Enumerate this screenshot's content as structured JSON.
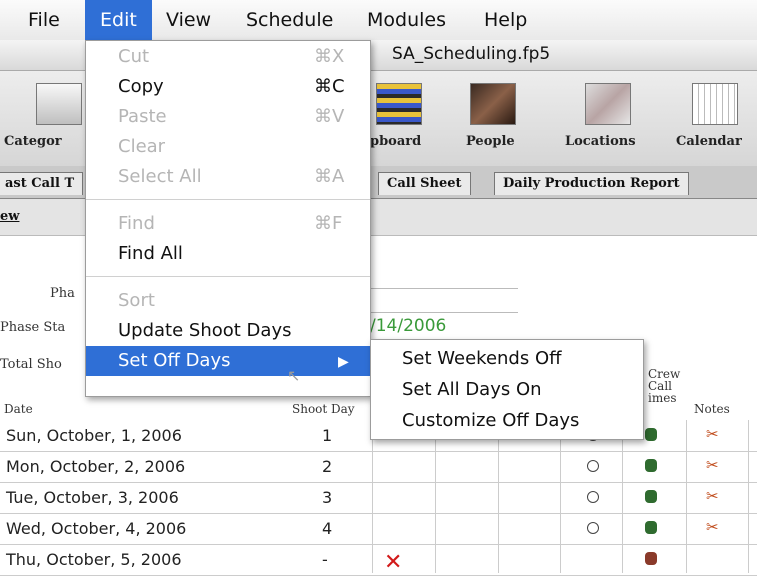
{
  "menubar": {
    "items": [
      "File",
      "Edit",
      "View",
      "Schedule",
      "Modules",
      "Help"
    ]
  },
  "window": {
    "title": "SA_Scheduling.fp5"
  },
  "toolbar": {
    "items": [
      {
        "label": "Categor",
        "icon": "categories-icon"
      },
      {
        "label": "pboard",
        "icon": "stripboard-icon"
      },
      {
        "label": "People",
        "icon": "people-icon"
      },
      {
        "label": "Locations",
        "icon": "locations-icon"
      },
      {
        "label": "Calendar",
        "icon": "calendar-icon"
      }
    ]
  },
  "tabs": [
    "ast Call T",
    "Call Sheet",
    "Daily Production Report"
  ],
  "subbar": {
    "view_link": "ew"
  },
  "form": {
    "phase_label": "Pha",
    "phase_start_label": "Phase Sta",
    "phase_start_value": "/14/2006",
    "total_label": "Total Sho"
  },
  "table": {
    "headers": {
      "date": "Date",
      "shoot_day": "Shoot Day",
      "crew": "Crew Call Times",
      "crew_lines": [
        "Crew",
        "Call",
        "imes"
      ],
      "notes": "Notes"
    },
    "rows": [
      {
        "date": "Sun, October, 1, 2006",
        "shoot_day": "1"
      },
      {
        "date": "Mon, October, 2, 2006",
        "shoot_day": "2"
      },
      {
        "date": "Tue, October, 3, 2006",
        "shoot_day": "3"
      },
      {
        "date": "Wed, October, 4, 2006",
        "shoot_day": "4"
      },
      {
        "date": "Thu, October, 5, 2006",
        "shoot_day": "-"
      }
    ]
  },
  "edit_menu": {
    "cut": {
      "label": "Cut",
      "shortcut": "⌘X"
    },
    "copy": {
      "label": "Copy",
      "shortcut": "⌘C"
    },
    "paste": {
      "label": "Paste",
      "shortcut": "⌘V"
    },
    "clear": {
      "label": "Clear"
    },
    "select_all": {
      "label": "Select All",
      "shortcut": "⌘A"
    },
    "find": {
      "label": "Find",
      "shortcut": "⌘F"
    },
    "find_all": {
      "label": "Find All"
    },
    "sort": {
      "label": "Sort"
    },
    "update_shoot_days": {
      "label": "Update Shoot Days"
    },
    "set_off_days": {
      "label": "Set Off Days",
      "arrow": "▶"
    }
  },
  "submenu": {
    "items": [
      "Set Weekends Off",
      "Set All Days On",
      "Customize Off Days"
    ]
  },
  "colors": {
    "highlight": "#2f6fd6",
    "date_green": "#3a9a3a",
    "off_day_red": "#d21a1a"
  }
}
